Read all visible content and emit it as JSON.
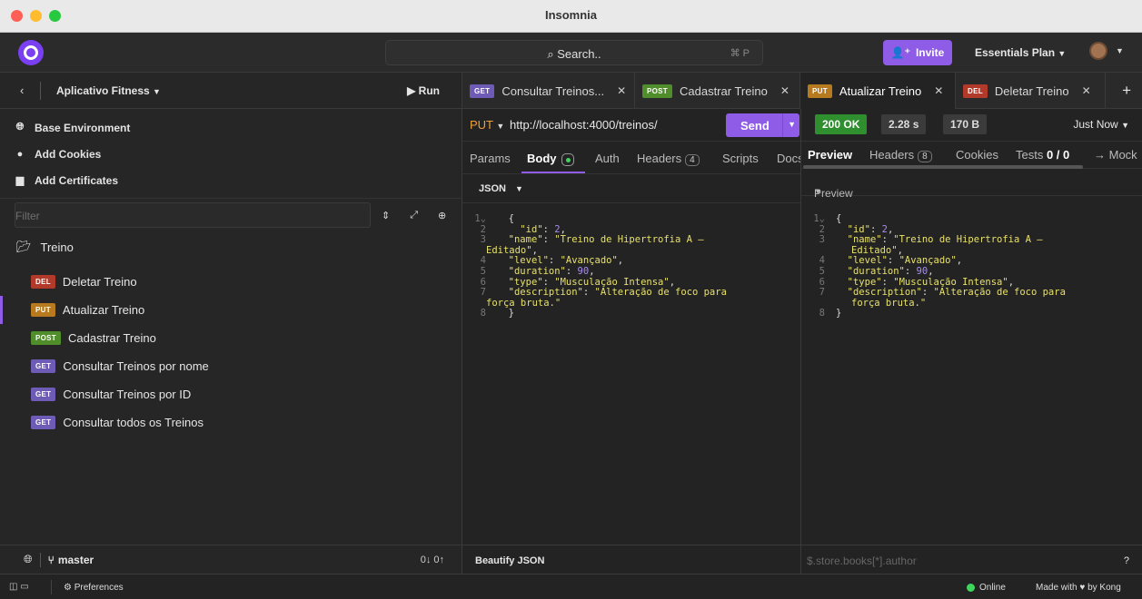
{
  "window": {
    "title": "Insomnia"
  },
  "topbar": {
    "search_label": "Search..",
    "search_shortcut": "⌘ P",
    "invite_label": "Invite",
    "plan_label": "Essentials Plan"
  },
  "project": {
    "name": "Aplicativo Fitness",
    "run_label": "Run"
  },
  "environments": [
    "Base Environment",
    "Add Cookies",
    "Add Certificates"
  ],
  "filter": {
    "placeholder": "Filter"
  },
  "folder": {
    "name": "Treino"
  },
  "requests": [
    {
      "method": "DEL",
      "name": "Deletar Treino"
    },
    {
      "method": "PUT",
      "name": "Atualizar Treino"
    },
    {
      "method": "POST",
      "name": "Cadastrar Treino"
    },
    {
      "method": "GET",
      "name": "Consultar Treinos por nome"
    },
    {
      "method": "GET",
      "name": "Consultar Treinos por ID"
    },
    {
      "method": "GET",
      "name": "Consultar todos os Treinos"
    }
  ],
  "git": {
    "branch": "master",
    "sync": "0↓ 0↑"
  },
  "tabs": [
    {
      "method": "GET",
      "name": "Consultar Treinos..."
    },
    {
      "method": "POST",
      "name": "Cadastrar Treino"
    },
    {
      "method": "PUT",
      "name": "Atualizar Treino"
    },
    {
      "method": "DEL",
      "name": "Deletar Treino"
    }
  ],
  "request": {
    "method": "PUT",
    "url": "http://localhost:4000/treinos/",
    "send_label": "Send",
    "subtabs": {
      "params": "Params",
      "body": "Body",
      "auth": "Auth",
      "headers": "Headers",
      "headers_count": "4",
      "scripts": "Scripts",
      "docs": "Docs"
    },
    "body_type": "JSON",
    "beautify_label": "Beautify JSON"
  },
  "response": {
    "status": "200 OK",
    "time": "2.28 s",
    "size": "170 B",
    "when": "Just Now",
    "tabs": {
      "preview": "Preview",
      "headers": "Headers",
      "headers_count": "8",
      "cookies": "Cookies",
      "tests": "Tests",
      "tests_count": "0 / 0",
      "mock": "→ Mock"
    },
    "preview_label": "Preview",
    "filter_placeholder": "$.store.books[*].author"
  },
  "json_body": {
    "id": "2",
    "name_part1": "\"Treino de Hipertrofia A –",
    "name_part2": "Editado\"",
    "level": "\"Avançado\"",
    "duration": "90",
    "type": "\"Musculação Intensa\"",
    "desc_part1": "\"Alteração de foco para",
    "desc_part2": "força bruta.\""
  },
  "statusbar": {
    "preferences": "Preferences",
    "online": "Online",
    "made_with": "Made with ♥ by Kong"
  },
  "colors": {
    "accent": "#8f5ce8",
    "ok": "#2f8f2f",
    "del": "#b23a2a",
    "put": "#b87a1e",
    "post": "#4f8e2a",
    "get": "#6e5bb5"
  }
}
